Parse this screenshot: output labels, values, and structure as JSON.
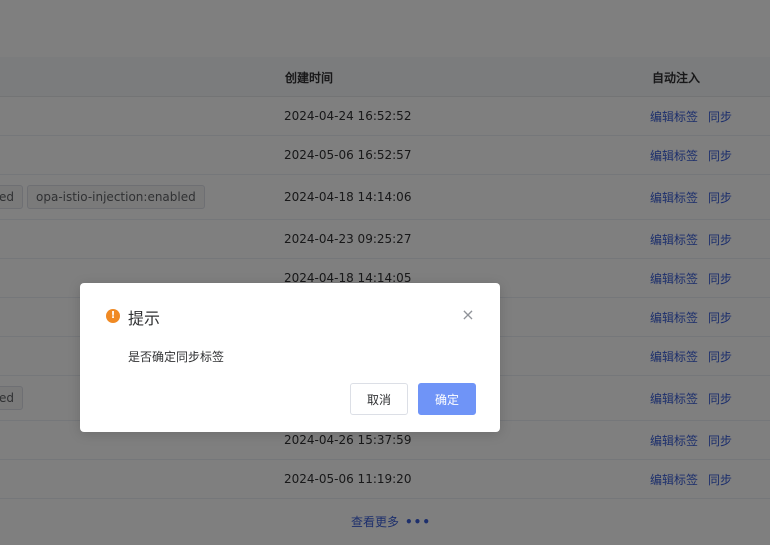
{
  "table": {
    "columns": {
      "created_time": "创建时间",
      "auto_inject": "自动注入"
    },
    "rows": [
      {
        "time": "2024-04-24 16:52:52",
        "edit_label": "编辑标签",
        "sync_label": "同步"
      },
      {
        "time": "2024-05-06 16:52:57",
        "edit_label": "编辑标签",
        "sync_label": "同步"
      },
      {
        "time": "2024-04-18 14:14:06",
        "edit_label": "编辑标签",
        "sync_label": "同步",
        "tags": [
          "ed",
          "opa-istio-injection:enabled"
        ]
      },
      {
        "time": "2024-04-23 09:25:27",
        "edit_label": "编辑标签",
        "sync_label": "同步"
      },
      {
        "time": "2024-04-18 14:14:05",
        "edit_label": "编辑标签",
        "sync_label": "同步"
      },
      {
        "time": "",
        "edit_label": "编辑标签",
        "sync_label": "同步"
      },
      {
        "time": "",
        "edit_label": "编辑标签",
        "sync_label": "同步"
      },
      {
        "time": "",
        "edit_label": "编辑标签",
        "sync_label": "同步",
        "tags": [
          "ed"
        ]
      },
      {
        "time": "2024-04-26 15:37:59",
        "edit_label": "编辑标签",
        "sync_label": "同步"
      },
      {
        "time": "2024-05-06 11:19:20",
        "edit_label": "编辑标签",
        "sync_label": "同步"
      }
    ]
  },
  "view_more": "查看更多",
  "dialog": {
    "title": "提示",
    "message": "是否确定同步标签",
    "cancel_label": "取消",
    "ok_label": "确定",
    "warn_glyph": "!",
    "close_glyph": "×"
  },
  "colors": {
    "link": "#3a5fd9",
    "primary": "#6f94f7",
    "warning": "#f08a24"
  }
}
